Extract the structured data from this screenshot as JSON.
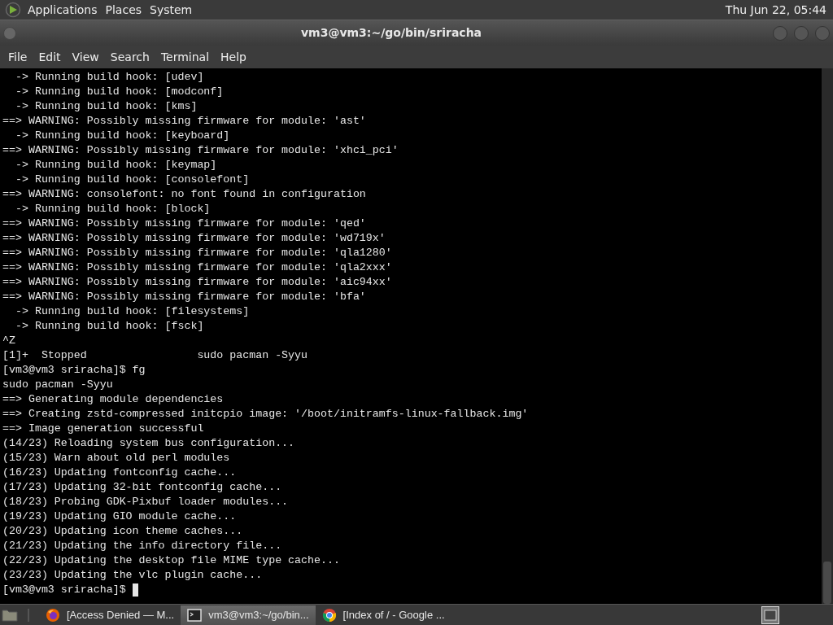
{
  "top_panel": {
    "menus": [
      "Applications",
      "Places",
      "System"
    ],
    "clock": "Thu Jun 22, 05:44"
  },
  "window": {
    "title": "vm3@vm3:~/go/bin/sriracha"
  },
  "menu_bar": [
    "File",
    "Edit",
    "View",
    "Search",
    "Terminal",
    "Help"
  ],
  "terminal": {
    "lines": [
      "  -> Running build hook: [udev]",
      "  -> Running build hook: [modconf]",
      "  -> Running build hook: [kms]",
      "==> WARNING: Possibly missing firmware for module: 'ast'",
      "  -> Running build hook: [keyboard]",
      "==> WARNING: Possibly missing firmware for module: 'xhci_pci'",
      "  -> Running build hook: [keymap]",
      "  -> Running build hook: [consolefont]",
      "==> WARNING: consolefont: no font found in configuration",
      "  -> Running build hook: [block]",
      "==> WARNING: Possibly missing firmware for module: 'qed'",
      "==> WARNING: Possibly missing firmware for module: 'wd719x'",
      "==> WARNING: Possibly missing firmware for module: 'qla1280'",
      "==> WARNING: Possibly missing firmware for module: 'qla2xxx'",
      "==> WARNING: Possibly missing firmware for module: 'aic94xx'",
      "==> WARNING: Possibly missing firmware for module: 'bfa'",
      "  -> Running build hook: [filesystems]",
      "  -> Running build hook: [fsck]",
      "^Z",
      "[1]+  Stopped                 sudo pacman -Syyu",
      "[vm3@vm3 sriracha]$ fg",
      "sudo pacman -Syyu",
      "==> Generating module dependencies",
      "==> Creating zstd-compressed initcpio image: '/boot/initramfs-linux-fallback.img'",
      "==> Image generation successful",
      "(14/23) Reloading system bus configuration...",
      "(15/23) Warn about old perl modules",
      "(16/23) Updating fontconfig cache...",
      "(17/23) Updating 32-bit fontconfig cache...",
      "(18/23) Probing GDK-Pixbuf loader modules...",
      "(19/23) Updating GIO module cache...",
      "(20/23) Updating icon theme caches...",
      "(21/23) Updating the info directory file...",
      "(22/23) Updating the desktop file MIME type cache...",
      "(23/23) Updating the vlc plugin cache...",
      "[vm3@vm3 sriracha]$ "
    ]
  },
  "taskbar": {
    "items": [
      {
        "kind": "firefox",
        "label": "[Access Denied — M...",
        "selected": false
      },
      {
        "kind": "terminal",
        "label": "vm3@vm3:~/go/bin...",
        "selected": true
      },
      {
        "kind": "chrome",
        "label": "[Index of / - Google ...",
        "selected": false
      }
    ]
  }
}
